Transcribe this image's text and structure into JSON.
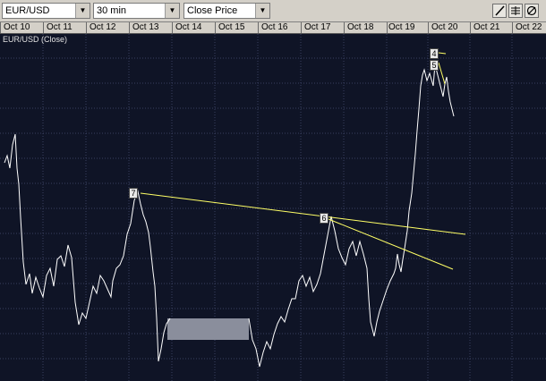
{
  "toolbar": {
    "symbol": "EUR/USD",
    "interval": "30 min",
    "price_type": "Close Price"
  },
  "icons": {
    "draw_line": "pencil-line-icon",
    "grid": "grid-icon",
    "no_draw": "no-draw-icon"
  },
  "timebar": {
    "dates": [
      "Oct 10",
      "Oct 11",
      "Oct 12",
      "Oct 13",
      "Oct 14",
      "Oct 15",
      "Oct 16",
      "Oct 17",
      "Oct 18",
      "Oct 19",
      "Oct 20",
      "Oct 21",
      "Oct 22"
    ]
  },
  "chart": {
    "series_label": "EUR/USD (Close)",
    "line_color": "#ffffff",
    "trendline_color": "#ffff66",
    "background_color": "#0f1426",
    "grid_color": "#3a4060",
    "markers": [
      "7",
      "6",
      "4",
      "5"
    ]
  }
}
